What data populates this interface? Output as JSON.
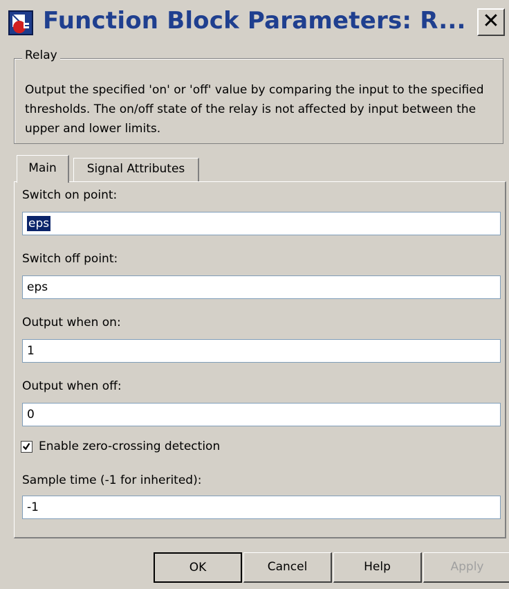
{
  "window": {
    "title": "Function Block Parameters: R...",
    "close_label": "✕"
  },
  "block": {
    "group_label": "Relay",
    "description": "Output the specified 'on' or 'off' value by comparing the input to the specified thresholds.  The on/off state of the relay is not affected by input between the upper and lower limits."
  },
  "tabs": [
    {
      "label": "Main",
      "selected": true
    },
    {
      "label": "Signal Attributes",
      "selected": false
    }
  ],
  "params": {
    "switch_on": {
      "label": "Switch on point:",
      "value": "eps"
    },
    "switch_off": {
      "label": "Switch off point:",
      "value": "eps"
    },
    "output_on": {
      "label": "Output when on:",
      "value": "1"
    },
    "output_off": {
      "label": "Output when off:",
      "value": "0"
    },
    "zero_crossing": {
      "label": "Enable zero-crossing detection",
      "checked": true
    },
    "sample_time": {
      "label": "Sample time (-1 for inherited):",
      "value": "-1"
    }
  },
  "buttons": {
    "ok": "OK",
    "cancel": "Cancel",
    "help": "Help",
    "apply": "Apply"
  },
  "colors": {
    "dialog_bg": "#d4d0c8",
    "title_text": "#1f3f8f",
    "selection": "#0a246a"
  }
}
